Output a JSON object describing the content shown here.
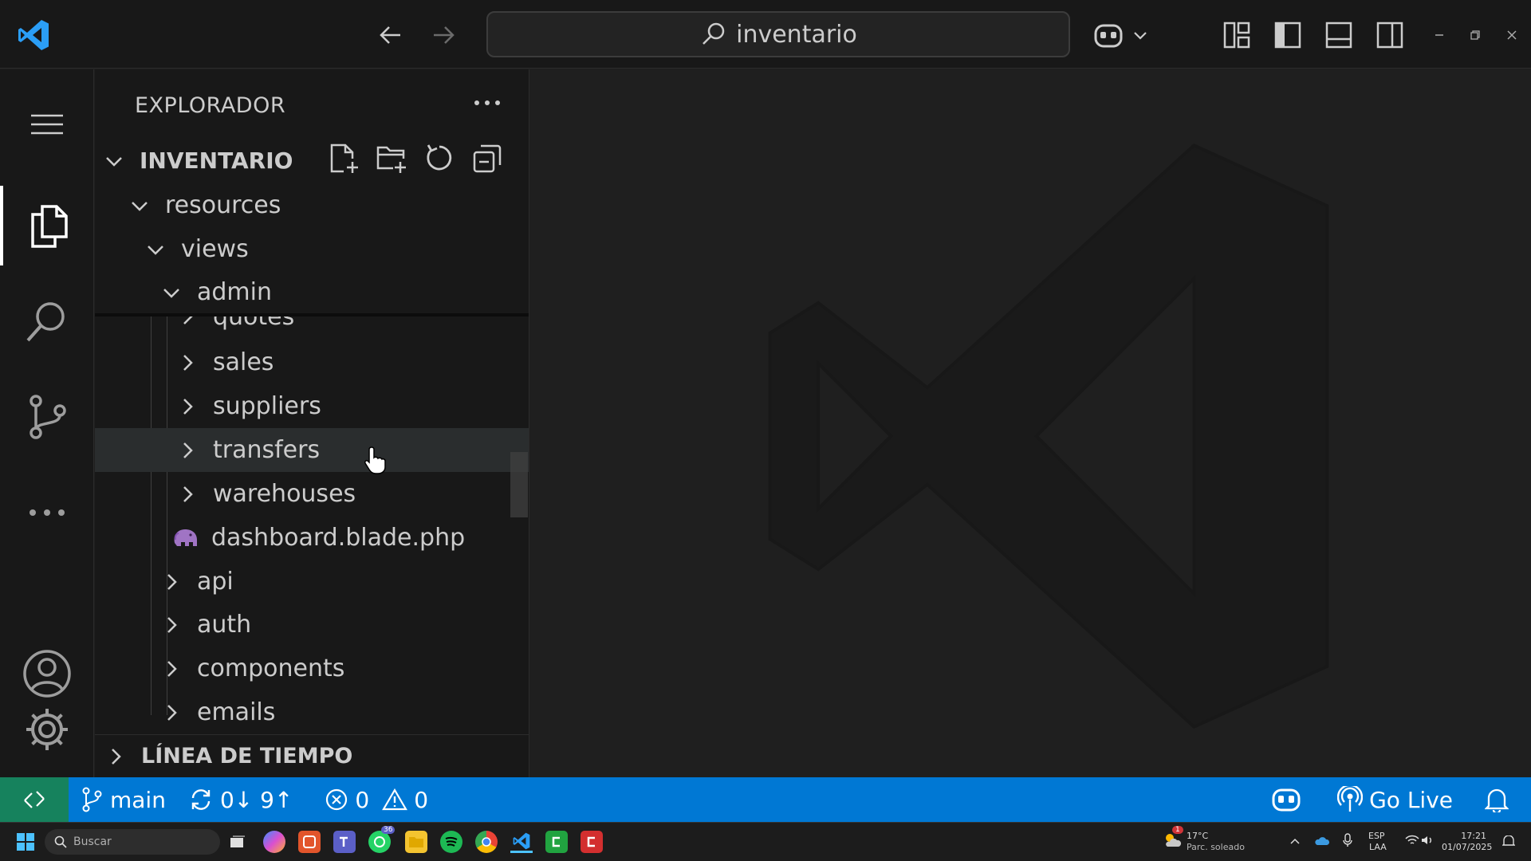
{
  "titlebar": {
    "search_text": "inventario"
  },
  "sidebar": {
    "title": "EXPLORADOR",
    "project": "INVENTARIO",
    "tree": [
      {
        "label": "resources",
        "type": "folder",
        "expanded": true
      },
      {
        "label": "views",
        "type": "folder",
        "expanded": true
      },
      {
        "label": "admin",
        "type": "folder",
        "expanded": true
      },
      {
        "label": "quotes",
        "type": "folder",
        "expanded": false
      },
      {
        "label": "sales",
        "type": "folder",
        "expanded": false
      },
      {
        "label": "suppliers",
        "type": "folder",
        "expanded": false
      },
      {
        "label": "transfers",
        "type": "folder",
        "expanded": false
      },
      {
        "label": "warehouses",
        "type": "folder",
        "expanded": false
      },
      {
        "label": "dashboard.blade.php",
        "type": "file",
        "icon": "php-elephant-icon"
      },
      {
        "label": "api",
        "type": "folder",
        "expanded": false
      },
      {
        "label": "auth",
        "type": "folder",
        "expanded": false
      },
      {
        "label": "components",
        "type": "folder",
        "expanded": false
      },
      {
        "label": "emails",
        "type": "folder",
        "expanded": false
      }
    ],
    "timeline": "LÍNEA DE TIEMPO"
  },
  "statusbar": {
    "branch": "main",
    "sync": "0↓ 9↑",
    "errors": "0",
    "warnings": "0",
    "go_live": "Go Live"
  },
  "taskbar": {
    "search_placeholder": "Buscar",
    "weather_temp": "17°C",
    "weather_desc": "Parc. soleado",
    "weather_badge": "1",
    "teams_badge": "36",
    "lang_top": "ESP",
    "lang_bottom": "LAA",
    "time": "17:21",
    "date": "01/07/2025"
  },
  "colors": {
    "statusbar": "#0078d4",
    "remote": "#16825d",
    "php_icon": "#a074c4"
  }
}
